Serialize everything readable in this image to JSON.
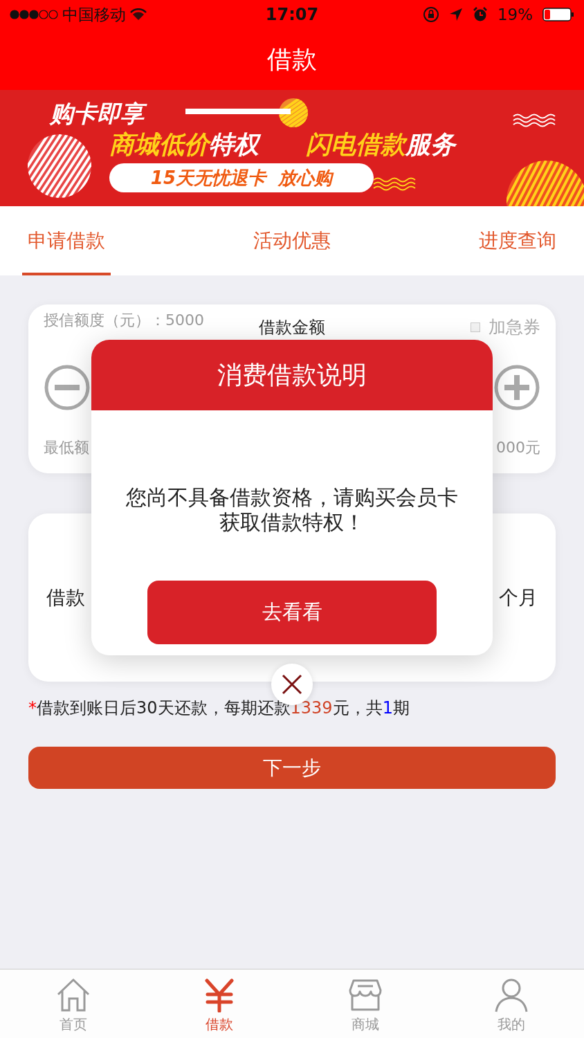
{
  "status_bar": {
    "carrier": "中国移动",
    "time": "17:07",
    "battery": "19%"
  },
  "nav_bar": {
    "title": "借款"
  },
  "banner": {
    "headline": "购卡即享",
    "lines": [
      {
        "segments": [
          {
            "text": "商城低价",
            "kind": "highlight"
          },
          {
            "text": "特权",
            "kind": "plain"
          }
        ]
      },
      {
        "segments": [
          {
            "text": "闪电借款",
            "kind": "highlight"
          },
          {
            "text": "服务",
            "kind": "plain"
          }
        ]
      }
    ],
    "pill": "15天无忧退卡  放心购"
  },
  "tabs": [
    {
      "label": "申请借款",
      "selected": true
    },
    {
      "label": "活动优惠",
      "selected": false
    },
    {
      "label": "进度查询",
      "selected": false
    }
  ],
  "credit_card": {
    "credit_label": "授信额度（元）：5000",
    "urgent_coupon": {
      "label": "加急券",
      "checked": false
    },
    "amount_title": "借款金额",
    "min_label": "最低额",
    "max_label": "000元"
  },
  "term_card": {
    "left_label": "借款",
    "right_label": "个月"
  },
  "note": {
    "segments": [
      {
        "text": "*",
        "kind": "required"
      },
      {
        "text": "借款到账日后30天还款，每期还款",
        "kind": "plain"
      },
      {
        "text": "1339",
        "kind": "amount"
      },
      {
        "text": "元，共",
        "kind": "plain"
      },
      {
        "text": "1",
        "kind": "count"
      },
      {
        "text": "期",
        "kind": "plain"
      }
    ]
  },
  "next_button": "下一步",
  "modal": {
    "title": "消费借款说明",
    "message": "您尚不具备借款资格，请购买会员卡获取借款特权！",
    "button": "去看看"
  },
  "bottom_nav": [
    {
      "label": "首页",
      "kind": "home",
      "selected": false
    },
    {
      "label": "借款",
      "kind": "loan",
      "selected": true
    },
    {
      "label": "商城",
      "kind": "shop",
      "selected": false
    },
    {
      "label": "我的",
      "kind": "profile",
      "selected": false
    }
  ]
}
